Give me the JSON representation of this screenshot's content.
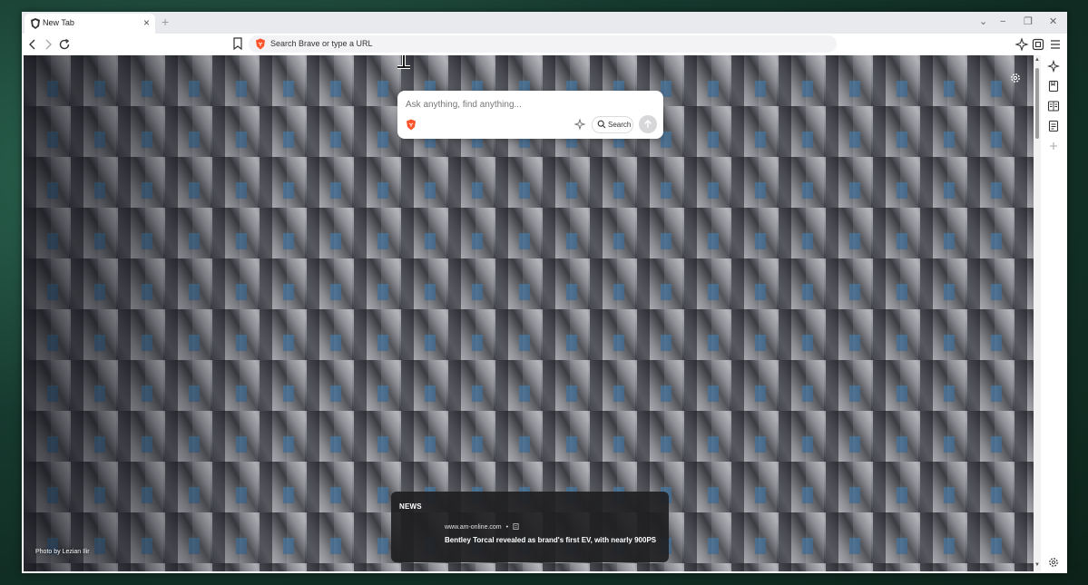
{
  "tab": {
    "title": "New Tab",
    "close": "×"
  },
  "tabstrip": {
    "new_tab": "+",
    "minimize": "−",
    "restore": "❐",
    "close": "✕",
    "dropdown": "⌄"
  },
  "toolbar": {
    "url_placeholder": "Search Brave or type a URL"
  },
  "ntp": {
    "search_placeholder": "Ask anything, find anything...",
    "search_button_label": "Search",
    "photo_credit": "Photo by Lezian Ilir",
    "news": {
      "label": "NEWS",
      "source": "www.am-online.com",
      "separator": "•",
      "headline": "Bentley Torcal revealed as brand's first EV, with nearly 900PS"
    }
  },
  "colors": {
    "brave_orange": "#fb542b",
    "tabstrip_bg": "#e9eaee",
    "news_card_bg": "#202022"
  },
  "icons": {
    "favicon": "brave-shield-icon",
    "back": "arrow-left-icon",
    "forward": "arrow-right-icon",
    "reload": "reload-icon",
    "bookmark": "bookmark-icon",
    "leo": "leo-ai-icon",
    "wallet": "wallet-icon",
    "menu": "hamburger-menu-icon"
  }
}
